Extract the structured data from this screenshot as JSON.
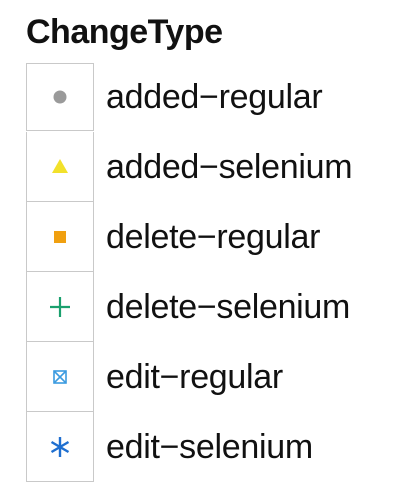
{
  "chart_data": {
    "type": "scatter",
    "title": "",
    "legend": {
      "title": "ChangeType",
      "placement": "standalone",
      "entries": [
        {
          "label": "added−regular",
          "shape": "circle-icon",
          "color": "#9a9a9a"
        },
        {
          "label": "added−selenium",
          "shape": "triangle-icon",
          "color": "#f2e12b"
        },
        {
          "label": "delete−regular",
          "shape": "square-icon",
          "color": "#f0a010"
        },
        {
          "label": "delete−selenium",
          "shape": "plus-icon",
          "color": "#1aa06e"
        },
        {
          "label": "edit−regular",
          "shape": "boxed-x-icon",
          "color": "#3b9be0"
        },
        {
          "label": "edit−selenium",
          "shape": "asterisk-icon",
          "color": "#1f6fd0"
        }
      ]
    }
  }
}
